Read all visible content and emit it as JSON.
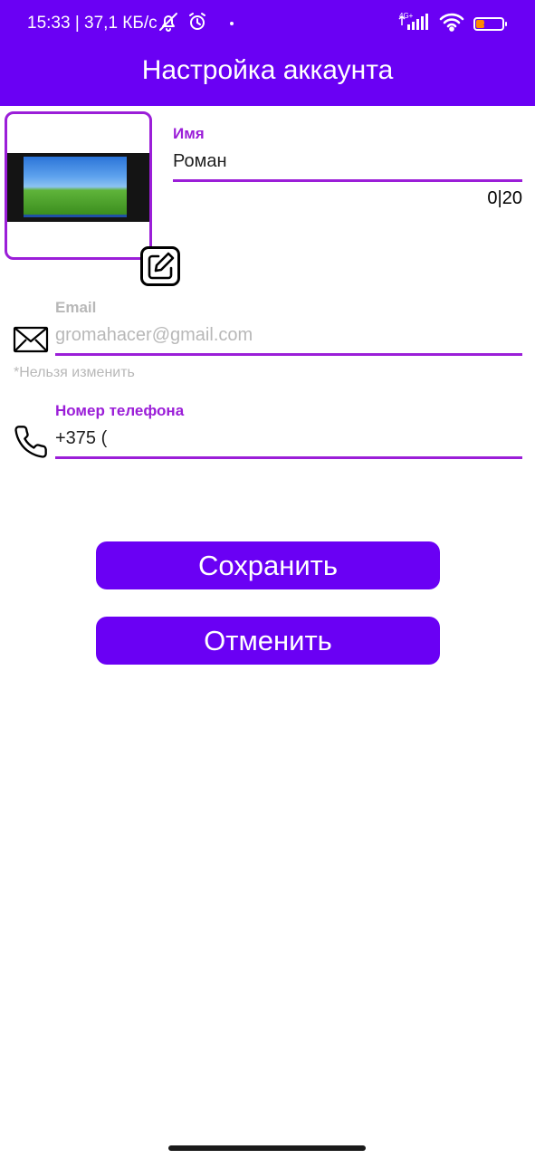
{
  "status_bar": {
    "time": "15:33 | 37,1 КБ/с",
    "network_type": "4G+",
    "battery_level": "30",
    "icons": [
      "bell-off-icon",
      "alarm-icon",
      "signal-icon",
      "wifi-icon",
      "battery-icon"
    ]
  },
  "header": {
    "title": "Настройка аккаунта"
  },
  "profile": {
    "name_label": "Имя",
    "name_value": "Роман",
    "name_counter": "0|20"
  },
  "email": {
    "label": "Email",
    "value": "gromahacer@gmail.com",
    "helper": "*Нельзя изменить"
  },
  "phone": {
    "label": "Номер телефона",
    "value": "+375 ("
  },
  "actions": {
    "save_label": "Сохранить",
    "cancel_label": "Отменить"
  },
  "colors": {
    "primary": "#6a00f4",
    "accent": "#9b1ed8",
    "disabled_text": "#b8b8b8"
  }
}
